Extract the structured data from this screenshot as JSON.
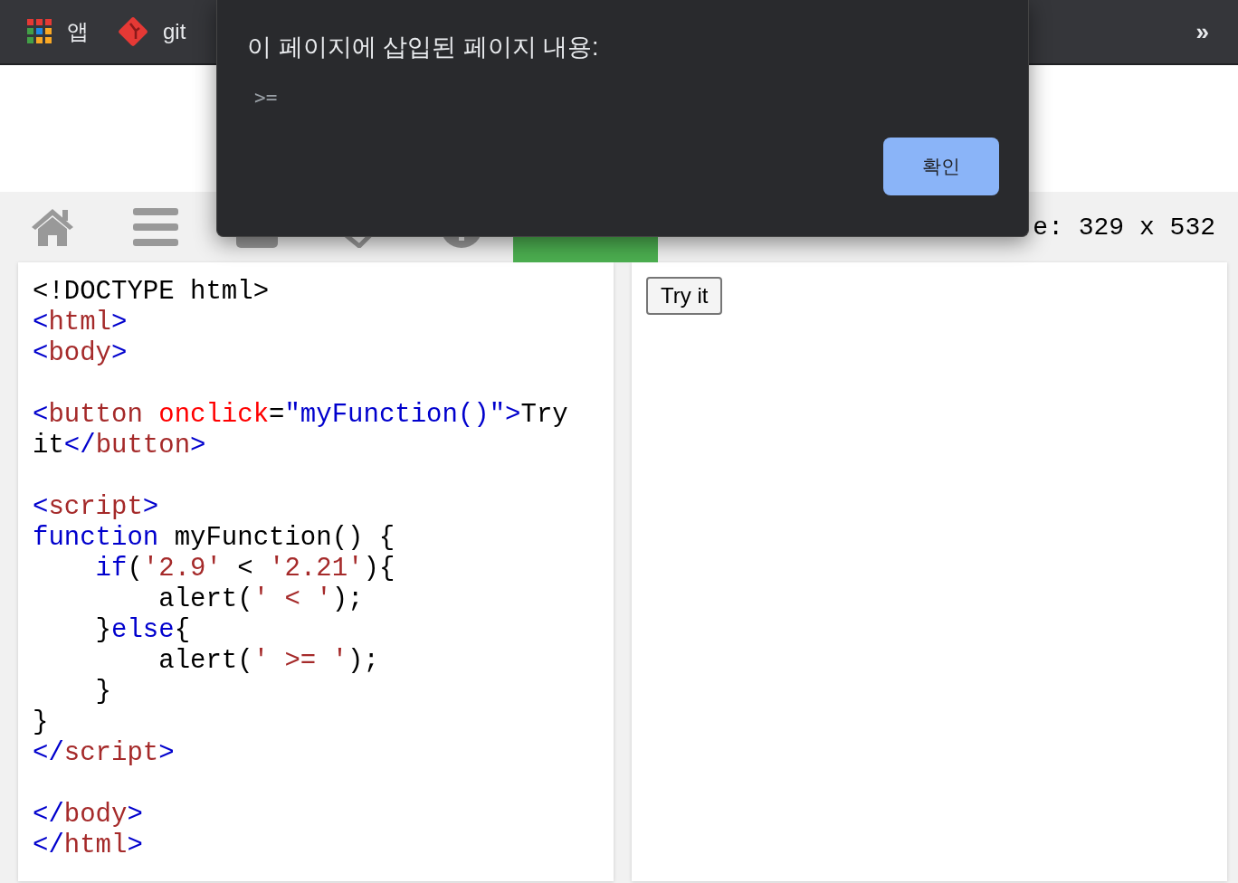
{
  "bookmarks_bar": {
    "items": [
      {
        "kind": "apps",
        "label": "앱"
      },
      {
        "kind": "git",
        "label": "git"
      }
    ],
    "overflow": "»"
  },
  "dialog": {
    "title": "이 페이지에 삽입된 페이지 내용:",
    "message": ">=",
    "button": "확인"
  },
  "toolbar": {
    "result_size": "e: 329 x 532"
  },
  "code_blocks": [
    [
      [
        {
          "kind": "plain",
          "text": "<!DOCTYPE html>"
        }
      ],
      [
        {
          "kind": "bracket",
          "text": "<"
        },
        {
          "kind": "tag",
          "text": "html"
        },
        {
          "kind": "bracket",
          "text": ">"
        }
      ],
      [
        {
          "kind": "bracket",
          "text": "<"
        },
        {
          "kind": "tag",
          "text": "body"
        },
        {
          "kind": "bracket",
          "text": ">"
        }
      ]
    ],
    [
      [
        {
          "kind": "bracket",
          "text": "<"
        },
        {
          "kind": "tag",
          "text": "button"
        },
        {
          "kind": "attr",
          "text": " onclick"
        },
        {
          "kind": "plain",
          "text": "="
        },
        {
          "kind": "value",
          "text": "\"myFunction()\""
        },
        {
          "kind": "bracket",
          "text": ">"
        },
        {
          "kind": "plain",
          "text": "Try"
        }
      ],
      [
        {
          "kind": "plain",
          "text": "it"
        },
        {
          "kind": "bracket",
          "text": "</"
        },
        {
          "kind": "tag",
          "text": "button"
        },
        {
          "kind": "bracket",
          "text": ">"
        }
      ]
    ],
    [
      [
        {
          "kind": "bracket",
          "text": "<"
        },
        {
          "kind": "tag",
          "text": "script"
        },
        {
          "kind": "bracket",
          "text": ">"
        }
      ],
      [
        {
          "kind": "keyword",
          "text": "function"
        },
        {
          "kind": "plain",
          "text": " myFunction() {"
        }
      ],
      [
        {
          "kind": "keyword",
          "text": "    if"
        },
        {
          "kind": "plain",
          "text": "("
        },
        {
          "kind": "string",
          "text": "'2.9'"
        },
        {
          "kind": "plain",
          "text": " < "
        },
        {
          "kind": "string",
          "text": "'2.21'"
        },
        {
          "kind": "plain",
          "text": "){"
        }
      ],
      [
        {
          "kind": "plain",
          "text": "        alert("
        },
        {
          "kind": "string",
          "text": "' < '"
        },
        {
          "kind": "plain",
          "text": ");"
        }
      ],
      [
        {
          "kind": "plain",
          "text": "    }"
        },
        {
          "kind": "keyword",
          "text": "else"
        },
        {
          "kind": "plain",
          "text": "{"
        }
      ],
      [
        {
          "kind": "plain",
          "text": "        alert("
        },
        {
          "kind": "string",
          "text": "' >= '"
        },
        {
          "kind": "plain",
          "text": ");"
        }
      ],
      [
        {
          "kind": "plain",
          "text": "    }"
        }
      ],
      [
        {
          "kind": "plain",
          "text": "}"
        }
      ],
      [
        {
          "kind": "bracket",
          "text": "</"
        },
        {
          "kind": "tag",
          "text": "script"
        },
        {
          "kind": "bracket",
          "text": ">"
        }
      ]
    ],
    [
      [
        {
          "kind": "bracket",
          "text": "</"
        },
        {
          "kind": "tag",
          "text": "body"
        },
        {
          "kind": "bracket",
          "text": ">"
        }
      ],
      [
        {
          "kind": "bracket",
          "text": "</"
        },
        {
          "kind": "tag",
          "text": "html"
        },
        {
          "kind": "bracket",
          "text": ">"
        }
      ]
    ]
  ],
  "preview": {
    "button": "Try it"
  }
}
